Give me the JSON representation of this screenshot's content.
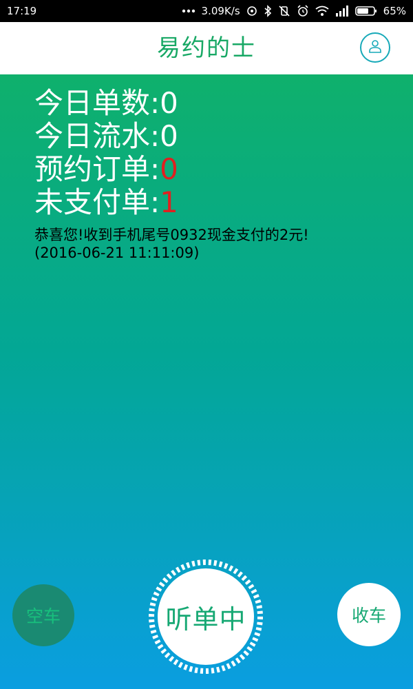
{
  "status_bar": {
    "time": "17:19",
    "network_speed": "3.09K/s",
    "battery": "65%",
    "icons": [
      "more-dots-icon",
      "sync-icon",
      "bluetooth-icon",
      "vibrate-off-icon",
      "alarm-icon",
      "wifi-icon",
      "signal-icon",
      "battery-icon"
    ]
  },
  "header": {
    "title": "易约的士",
    "profile_icon": "user-icon"
  },
  "stats": [
    {
      "label": "今日单数:",
      "value": "0",
      "highlight": false
    },
    {
      "label": "今日流水:",
      "value": "0",
      "highlight": false
    },
    {
      "label": "预约订单:",
      "value": "0",
      "highlight": true
    },
    {
      "label": "未支付单:",
      "value": "1",
      "highlight": true
    }
  ],
  "notice": {
    "message": "恭喜您!收到手机尾号0932现金支付的2元!",
    "date": "(2016-06-21 11:11:09)"
  },
  "controls": {
    "empty_label": "空车",
    "listen_label": "听单中",
    "close_label": "收车"
  },
  "colors": {
    "brand_green": "#18a865",
    "gradient_top": "#0fb06c",
    "gradient_bottom": "#0a9ee0",
    "alert_red": "#e02020"
  }
}
